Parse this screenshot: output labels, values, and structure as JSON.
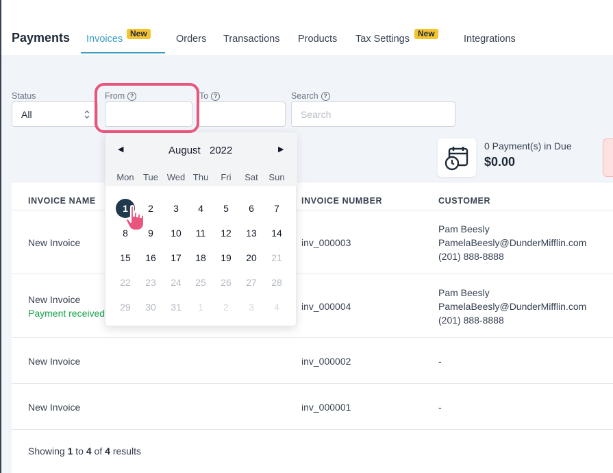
{
  "header": {
    "title": "Payments",
    "tabs": [
      {
        "label": "Invoices",
        "badge": "New",
        "active": true
      },
      {
        "label": "Orders"
      },
      {
        "label": "Transactions"
      },
      {
        "label": "Products"
      },
      {
        "label": "Tax Settings",
        "badge": "New"
      },
      {
        "label": "Integrations"
      }
    ]
  },
  "filters": {
    "status_label": "Status",
    "status_value": "All",
    "from_label": "From",
    "from_value": "",
    "to_label": "To",
    "to_value": "",
    "search_label": "Search",
    "search_placeholder": "Search"
  },
  "calendar": {
    "month": "August",
    "year": "2022",
    "weekdays": [
      "Mon",
      "Tue",
      "Wed",
      "Thu",
      "Fri",
      "Sat",
      "Sun"
    ],
    "weeks": [
      [
        "1",
        "2",
        "3",
        "4",
        "5",
        "6",
        "7"
      ],
      [
        "8",
        "9",
        "10",
        "11",
        "12",
        "13",
        "14"
      ],
      [
        "15",
        "16",
        "17",
        "18",
        "19",
        "20",
        "21"
      ],
      [
        "22",
        "23",
        "24",
        "25",
        "26",
        "27",
        "28"
      ],
      [
        "29",
        "30",
        "31",
        "1",
        "2",
        "3",
        "4"
      ]
    ],
    "selected_day": "1"
  },
  "due": {
    "count_text": "0  Payment(s) in Due",
    "amount": "$0.00"
  },
  "table": {
    "columns": [
      "INVOICE NAME",
      "INVOICE NUMBER",
      "CUSTOMER"
    ],
    "rows": [
      {
        "name": "New Invoice",
        "status": "",
        "number": "inv_000003",
        "customer_name": "Pam Beesly",
        "customer_email": "PamelaBeesly@DunderMifflin.com",
        "customer_phone": "(201) 888-8888"
      },
      {
        "name": "New Invoice",
        "status": "Payment received",
        "number": "inv_000004",
        "customer_name": "Pam Beesly",
        "customer_email": "PamelaBeesly@DunderMifflin.com",
        "customer_phone": "(201) 888-8888"
      },
      {
        "name": "New Invoice",
        "status": "",
        "number": "inv_000002",
        "customer_name": "-",
        "customer_email": "",
        "customer_phone": ""
      },
      {
        "name": "New Invoice",
        "status": "",
        "number": "inv_000001",
        "customer_name": "-",
        "customer_email": "",
        "customer_phone": ""
      }
    ]
  },
  "footer": {
    "prefix": "Showing",
    "from": "1",
    "to_word": "to",
    "to": "4",
    "of_word": "of",
    "total": "4",
    "suffix": "results"
  },
  "colors": {
    "accent": "#3b9ec2",
    "badge": "#f4c430",
    "highlight": "#e8557d",
    "selected_day": "#1e3a4c",
    "success": "#16a34a"
  }
}
